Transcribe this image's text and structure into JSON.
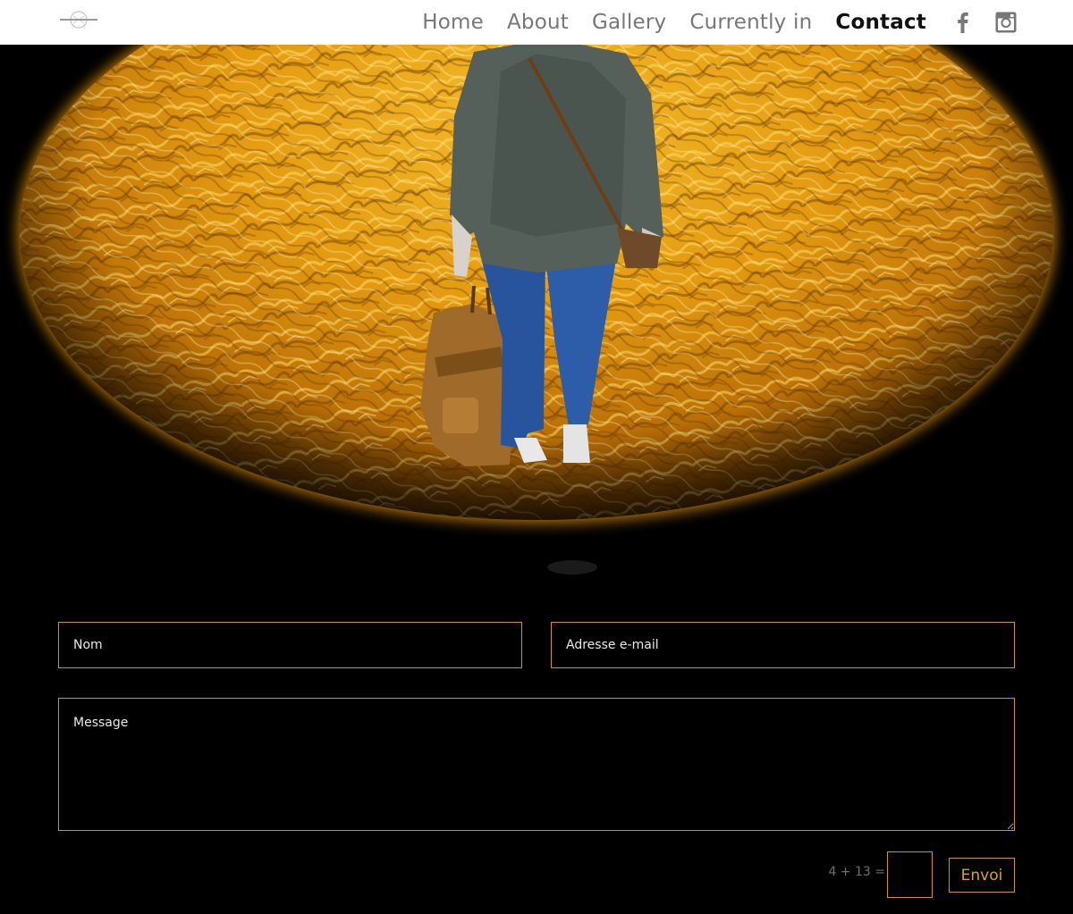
{
  "header": {
    "nav": [
      {
        "label": "Home"
      },
      {
        "label": "About"
      },
      {
        "label": "Gallery"
      },
      {
        "label": "Currently in"
      },
      {
        "label": "Contact",
        "active": true
      }
    ],
    "social": [
      {
        "icon": "facebook-icon"
      },
      {
        "icon": "instagram-icon"
      }
    ]
  },
  "hero": {
    "description_icon": "hero-image",
    "colors": {
      "gold": "#e09a10",
      "gold_light": "#f7c84a",
      "gold_dark": "#8a4e02",
      "background": "#000000"
    }
  },
  "form": {
    "name_placeholder": "Nom",
    "email_placeholder": "Adresse e-mail",
    "message_placeholder": "Message",
    "captcha_label": "4 + 13 =",
    "captcha_value": "",
    "submit_label": "Envoi",
    "accent_color": "#c9952b"
  }
}
